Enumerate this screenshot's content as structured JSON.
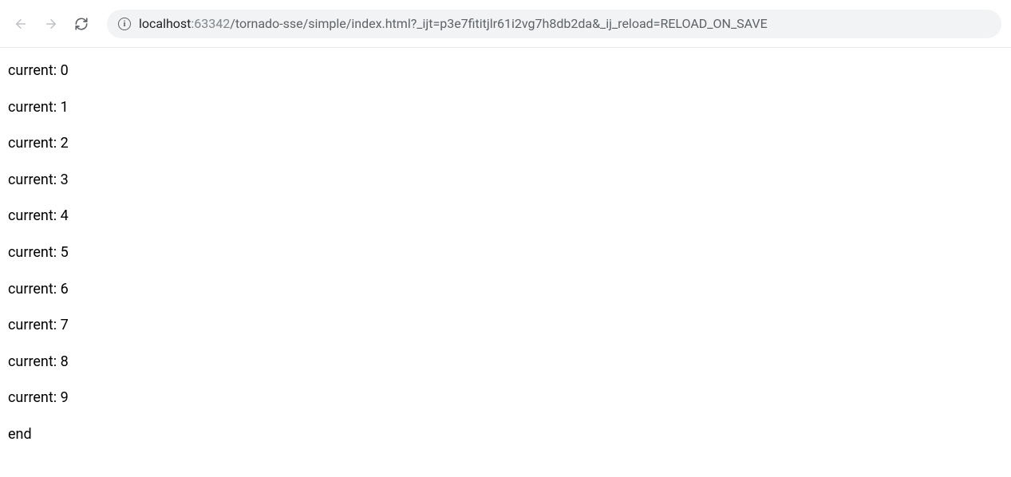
{
  "address": {
    "host": "localhost",
    "port": ":63342",
    "path": "/tornado-sse/simple/index.html?_ijt=p3e7fititjlr61i2vg7h8db2da&_ij_reload=RELOAD_ON_SAVE"
  },
  "content": {
    "lines": [
      "current: 0",
      "current: 1",
      "current: 2",
      "current: 3",
      "current: 4",
      "current: 5",
      "current: 6",
      "current: 7",
      "current: 8",
      "current: 9",
      "end"
    ]
  }
}
